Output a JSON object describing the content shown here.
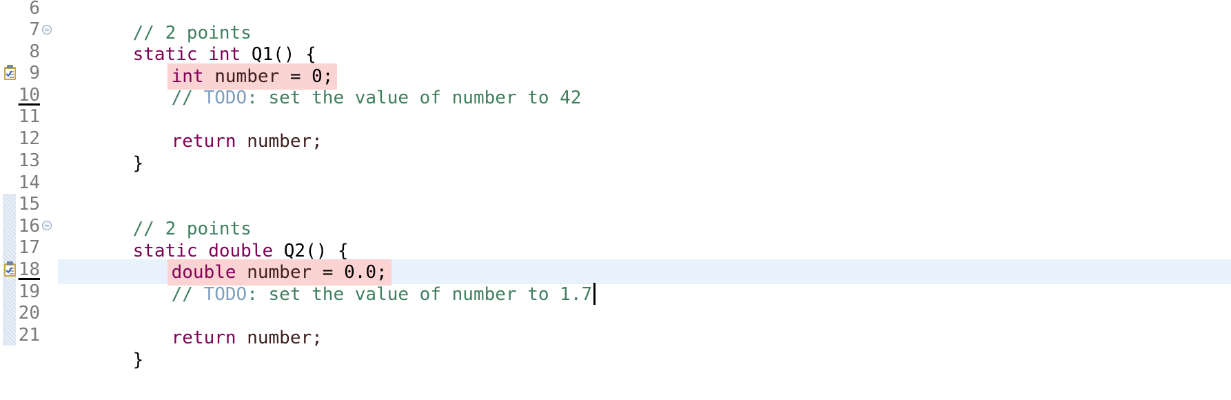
{
  "editor": {
    "lines": [
      {
        "num": "6"
      },
      {
        "num": "7"
      },
      {
        "num": "8"
      },
      {
        "num": "9"
      },
      {
        "num": "10"
      },
      {
        "num": "11"
      },
      {
        "num": "12"
      },
      {
        "num": "13"
      },
      {
        "num": "14"
      },
      {
        "num": "15"
      },
      {
        "num": "16"
      },
      {
        "num": "17"
      },
      {
        "num": "18"
      },
      {
        "num": "19"
      },
      {
        "num": "20"
      },
      {
        "num": "21"
      }
    ],
    "code": {
      "l6_comment": "// 2 points",
      "l7_static": "static",
      "l7_int": "int",
      "l7_name": "Q1() {",
      "l8_int": "int",
      "l8_var": "number",
      "l8_rest": "= 0;",
      "l9_slashes": "// ",
      "l9_todo": "TODO",
      "l9_rest": ": set the value of number to 42",
      "l11_return": "return",
      "l11_rest": "number;",
      "l12_brace": "}",
      "l15_comment": "// 2 points",
      "l16_static": "static",
      "l16_double": "double",
      "l16_name": "Q2() {",
      "l17_double": "double",
      "l17_var": "number",
      "l17_rest": "= 0.0;",
      "l18_slashes": "// ",
      "l18_todo": "TODO",
      "l18_rest": ": set the value of number to 1.7",
      "l20_return": "return",
      "l20_rest": "number;",
      "l21_brace": "}"
    },
    "colors": {
      "keyword": "#7f0055",
      "comment": "#3f7f5f",
      "todo_tag": "#7f9fbf",
      "error_highlight": "#fbd3d3",
      "current_line": "#e8f2fc"
    },
    "icons": [
      "fold-collapse-icon",
      "task-marker-icon"
    ]
  }
}
